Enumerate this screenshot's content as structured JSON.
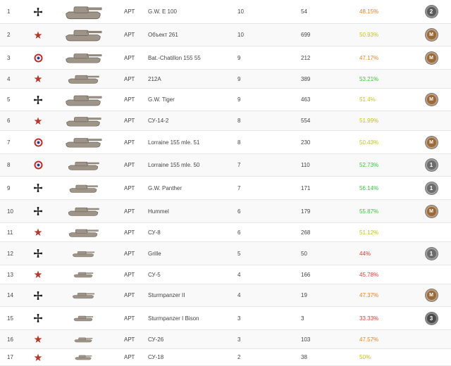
{
  "colors": {
    "red": "#e53935",
    "orange": "#e8852a",
    "yellow": "#c3c320",
    "green": "#3fc43f",
    "tank": "#9e9488",
    "medal_mastery": "#9a6a3a",
    "medal_class": "#666666"
  },
  "rows": [
    {
      "num": "1",
      "nation": "germany",
      "nation_icon": "iron-cross-icon",
      "type": "АРТ",
      "name": "G.W. E 100",
      "tier": "10",
      "battles": "54",
      "winrate": "48.15%",
      "wr_color": "orange",
      "medal": "2",
      "medal_kind": "class-2"
    },
    {
      "num": "2",
      "nation": "ussr",
      "nation_icon": "red-star-icon",
      "type": "АРТ",
      "name": "Объект 261",
      "tier": "10",
      "battles": "699",
      "winrate": "50.93%",
      "wr_color": "yellow",
      "medal": "M",
      "medal_kind": "mastery"
    },
    {
      "num": "3",
      "nation": "france",
      "nation_icon": "roundel-icon",
      "type": "АРТ",
      "name": "Bat.-Chatillon 155 55",
      "tier": "9",
      "battles": "212",
      "winrate": "47.17%",
      "wr_color": "orange",
      "medal": "M",
      "medal_kind": "mastery"
    },
    {
      "num": "4",
      "nation": "ussr",
      "nation_icon": "red-star-icon",
      "type": "АРТ",
      "name": "212A",
      "tier": "9",
      "battles": "389",
      "winrate": "53.21%",
      "wr_color": "green",
      "medal": "",
      "medal_kind": ""
    },
    {
      "num": "5",
      "nation": "germany",
      "nation_icon": "iron-cross-icon",
      "type": "АРТ",
      "name": "G.W. Tiger",
      "tier": "9",
      "battles": "463",
      "winrate": "51.4%",
      "wr_color": "yellow",
      "medal": "M",
      "medal_kind": "mastery"
    },
    {
      "num": "6",
      "nation": "ussr",
      "nation_icon": "red-star-icon",
      "type": "АРТ",
      "name": "СУ-14-2",
      "tier": "8",
      "battles": "554",
      "winrate": "51.99%",
      "wr_color": "yellow",
      "medal": "",
      "medal_kind": ""
    },
    {
      "num": "7",
      "nation": "france",
      "nation_icon": "roundel-icon",
      "type": "АРТ",
      "name": "Lorraine 155 mle. 51",
      "tier": "8",
      "battles": "230",
      "winrate": "50.43%",
      "wr_color": "yellow",
      "medal": "M",
      "medal_kind": "mastery"
    },
    {
      "num": "8",
      "nation": "france",
      "nation_icon": "roundel-icon",
      "type": "АРТ",
      "name": "Lorraine 155 mle. 50",
      "tier": "7",
      "battles": "110",
      "winrate": "52.73%",
      "wr_color": "green",
      "medal": "1",
      "medal_kind": "class-1"
    },
    {
      "num": "9",
      "nation": "germany",
      "nation_icon": "iron-cross-icon",
      "type": "АРТ",
      "name": "G.W. Panther",
      "tier": "7",
      "battles": "171",
      "winrate": "56.14%",
      "wr_color": "green",
      "medal": "1",
      "medal_kind": "class-1"
    },
    {
      "num": "10",
      "nation": "germany",
      "nation_icon": "iron-cross-icon",
      "type": "АРТ",
      "name": "Hummel",
      "tier": "6",
      "battles": "179",
      "winrate": "55.87%",
      "wr_color": "green",
      "medal": "M",
      "medal_kind": "mastery"
    },
    {
      "num": "11",
      "nation": "ussr",
      "nation_icon": "red-star-icon",
      "type": "АРТ",
      "name": "СУ-8",
      "tier": "6",
      "battles": "268",
      "winrate": "51.12%",
      "wr_color": "yellow",
      "medal": "",
      "medal_kind": ""
    },
    {
      "num": "12",
      "nation": "germany",
      "nation_icon": "iron-cross-icon",
      "type": "АРТ",
      "name": "Grille",
      "tier": "5",
      "battles": "50",
      "winrate": "44%",
      "wr_color": "red",
      "medal": "1",
      "medal_kind": "class-1"
    },
    {
      "num": "13",
      "nation": "ussr",
      "nation_icon": "red-star-icon",
      "type": "АРТ",
      "name": "СУ-5",
      "tier": "4",
      "battles": "166",
      "winrate": "45.78%",
      "wr_color": "red",
      "medal": "",
      "medal_kind": ""
    },
    {
      "num": "14",
      "nation": "germany",
      "nation_icon": "iron-cross-icon",
      "type": "АРТ",
      "name": "Sturmpanzer II",
      "tier": "4",
      "battles": "19",
      "winrate": "47.37%",
      "wr_color": "orange",
      "medal": "M",
      "medal_kind": "mastery"
    },
    {
      "num": "15",
      "nation": "germany",
      "nation_icon": "iron-cross-icon",
      "type": "АРТ",
      "name": "Sturmpanzer I Bison",
      "tier": "3",
      "battles": "3",
      "winrate": "33.33%",
      "wr_color": "red",
      "medal": "3",
      "medal_kind": "class-3"
    },
    {
      "num": "16",
      "nation": "ussr",
      "nation_icon": "red-star-icon",
      "type": "АРТ",
      "name": "СУ-26",
      "tier": "3",
      "battles": "103",
      "winrate": "47.57%",
      "wr_color": "orange",
      "medal": "",
      "medal_kind": ""
    },
    {
      "num": "17",
      "nation": "ussr",
      "nation_icon": "red-star-icon",
      "type": "АРТ",
      "name": "СУ-18",
      "tier": "2",
      "battles": "38",
      "winrate": "50%",
      "wr_color": "yellow",
      "medal": "",
      "medal_kind": ""
    }
  ]
}
